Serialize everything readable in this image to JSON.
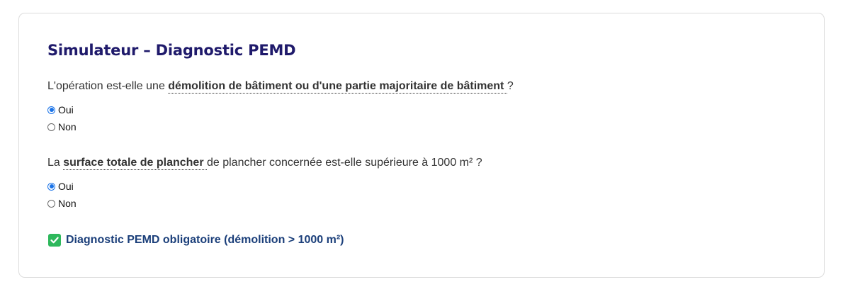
{
  "simulator": {
    "title": "Simulateur – Diagnostic PEMD",
    "questions": [
      {
        "prefix": "L'opération est-elle une ",
        "term": "démolition de bâtiment ou d'une partie majoritaire de bâtiment ",
        "suffix": "?",
        "options": [
          {
            "label": "Oui",
            "selected": true
          },
          {
            "label": "Non",
            "selected": false
          }
        ]
      },
      {
        "prefix": "La ",
        "term": "surface totale de plancher ",
        "suffix": "de plancher concernée est-elle supérieure à 1000 m² ?",
        "options": [
          {
            "label": "Oui",
            "selected": true
          },
          {
            "label": "Non",
            "selected": false
          }
        ]
      }
    ],
    "result": {
      "icon": "check-box-icon",
      "text": "Diagnostic PEMD obligatoire (démolition > 1000 m²)",
      "color": "#1b3f7a"
    }
  },
  "colors": {
    "title": "#1f1a6b",
    "radio_selected": "#1a73e8",
    "check_icon_bg": "#2eb85c"
  }
}
